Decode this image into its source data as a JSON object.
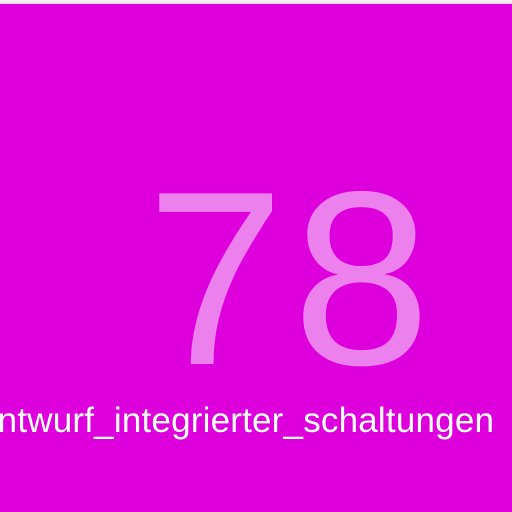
{
  "colors": {
    "tile_background": "#dd00dd",
    "number_color": "#ec80ec",
    "label_color": "#ffffff",
    "top_strip": "#f2eef2"
  },
  "tile": {
    "value": "78",
    "label": "entwurf_integrierter_schaltungen"
  }
}
